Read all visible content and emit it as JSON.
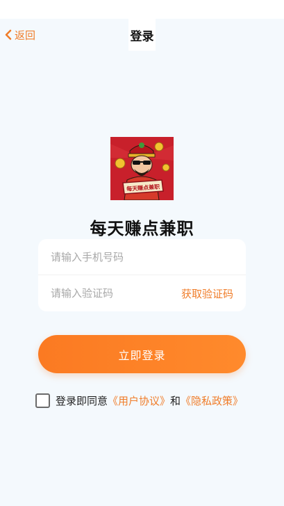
{
  "nav": {
    "back_label": "返回",
    "title": "登录"
  },
  "logo": {
    "banner_text": "每天赚点兼职"
  },
  "app_name": "每天赚点兼职",
  "form": {
    "phone_placeholder": "请输入手机号码",
    "code_placeholder": "请输入验证码",
    "get_code_label": "获取验证码"
  },
  "login_button_label": "立即登录",
  "agreement": {
    "prefix": "登录即同意",
    "user_agreement": "《用户协议》",
    "and": "和",
    "privacy_policy": "《隐私政策》",
    "checked": false
  },
  "colors": {
    "accent": "#f07d2a",
    "button": "#fb7a22",
    "background": "#f4f9fd",
    "logo_bg": "#c8202b"
  },
  "icons": [
    "chevron-left-icon",
    "app-logo",
    "checkbox-icon"
  ]
}
